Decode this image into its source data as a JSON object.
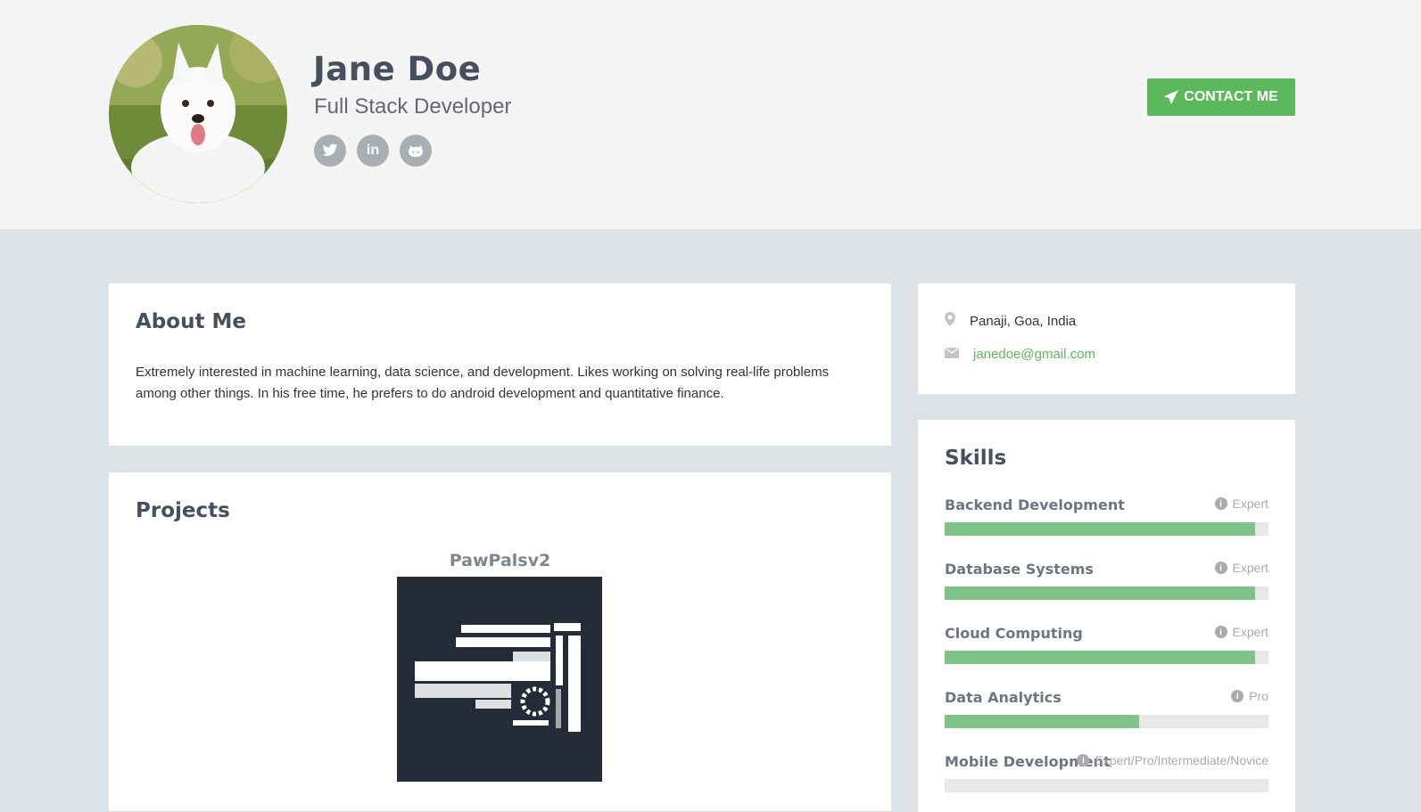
{
  "profile": {
    "name": "Jane Doe",
    "title": "Full Stack Developer",
    "avatar_alt": "white dog",
    "socials": [
      {
        "name": "twitter-icon",
        "glyph": "🐦"
      },
      {
        "name": "linkedin-icon",
        "glyph": "in"
      },
      {
        "name": "github-icon",
        "glyph": "🐱"
      }
    ]
  },
  "header": {
    "contact_label": "CONTACT ME"
  },
  "about": {
    "heading": "About Me",
    "text": "Extremely interested in machine learning, data science, and development. Likes working on solving real-life problems among other things. In his free time, he prefers to do android development and quantitative finance."
  },
  "projects": {
    "heading": "Projects",
    "items": [
      {
        "name": "PawPalsv2"
      }
    ]
  },
  "contact": {
    "location": "Panaji, Goa, India",
    "email": "janedoe@gmail.com"
  },
  "skills": {
    "heading": "Skills",
    "items": [
      {
        "name": "Backend Development",
        "level": "Expert",
        "progress": 0.96
      },
      {
        "name": "Database Systems",
        "level": "Expert",
        "progress": 0.96
      },
      {
        "name": "Cloud Computing",
        "level": "Expert",
        "progress": 0.96
      },
      {
        "name": "Data Analytics",
        "level": "Pro",
        "progress": 0.6
      },
      {
        "name": "Mobile Development",
        "level": "Expert/Pro/Intermediate/Novice",
        "progress": 0
      }
    ]
  },
  "colors": {
    "accent": "#5cb85c",
    "skill_bar": "#7ec387",
    "page_bg": "#dce2e5",
    "header_bg": "#f4f4f4"
  }
}
